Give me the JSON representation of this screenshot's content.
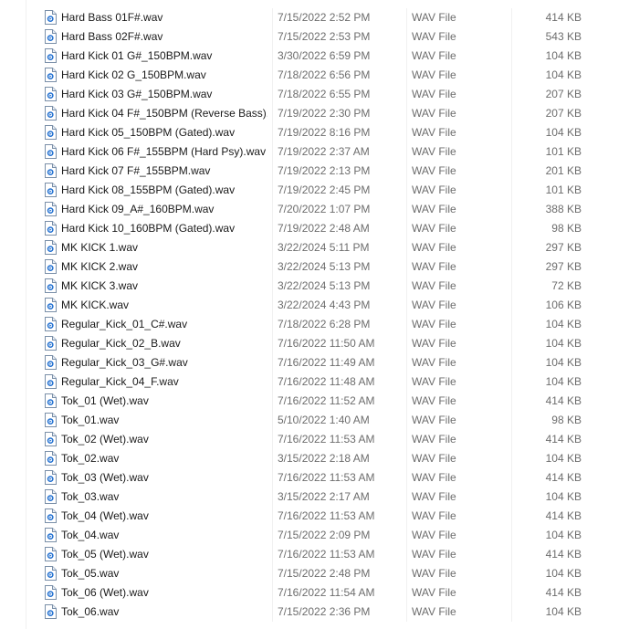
{
  "colors": {
    "icon_blue": "#1f6fd1",
    "secondary_text": "#6d6d6d"
  },
  "icon": "wav-audio-file-icon",
  "files": [
    {
      "name": "Hard Bass 01F#.wav",
      "date": "7/15/2022 2:52 PM",
      "type": "WAV File",
      "size": "414 KB"
    },
    {
      "name": "Hard Bass 02F#.wav",
      "date": "7/15/2022 2:53 PM",
      "type": "WAV File",
      "size": "543 KB"
    },
    {
      "name": "Hard Kick 01 G#_150BPM.wav",
      "date": "3/30/2022 6:59 PM",
      "type": "WAV File",
      "size": "104 KB"
    },
    {
      "name": "Hard Kick 02 G_150BPM.wav",
      "date": "7/18/2022 6:56 PM",
      "type": "WAV File",
      "size": "104 KB"
    },
    {
      "name": "Hard Kick 03 G#_150BPM.wav",
      "date": "7/18/2022 6:55 PM",
      "type": "WAV File",
      "size": "207 KB"
    },
    {
      "name": "Hard Kick 04 F#_150BPM (Reverse Bass)....",
      "date": "7/19/2022 2:30 PM",
      "type": "WAV File",
      "size": "207 KB"
    },
    {
      "name": "Hard Kick 05_150BPM (Gated).wav",
      "date": "7/19/2022 8:16 PM",
      "type": "WAV File",
      "size": "104 KB"
    },
    {
      "name": "Hard Kick 06 F#_155BPM (Hard Psy).wav",
      "date": "7/19/2022 2:37 AM",
      "type": "WAV File",
      "size": "101 KB"
    },
    {
      "name": "Hard Kick 07 F#_155BPM.wav",
      "date": "7/19/2022 2:13 PM",
      "type": "WAV File",
      "size": "201 KB"
    },
    {
      "name": "Hard Kick 08_155BPM (Gated).wav",
      "date": "7/19/2022 2:45 PM",
      "type": "WAV File",
      "size": "101 KB"
    },
    {
      "name": "Hard Kick 09_A#_160BPM.wav",
      "date": "7/20/2022 1:07 PM",
      "type": "WAV File",
      "size": "388 KB"
    },
    {
      "name": "Hard Kick 10_160BPM (Gated).wav",
      "date": "7/19/2022 2:48 AM",
      "type": "WAV File",
      "size": "98 KB"
    },
    {
      "name": "MK KICK 1.wav",
      "date": "3/22/2024 5:11 PM",
      "type": "WAV File",
      "size": "297 KB"
    },
    {
      "name": "MK KICK 2.wav",
      "date": "3/22/2024 5:13 PM",
      "type": "WAV File",
      "size": "297 KB"
    },
    {
      "name": "MK KICK 3.wav",
      "date": "3/22/2024 5:13 PM",
      "type": "WAV File",
      "size": "72 KB"
    },
    {
      "name": "MK KICK.wav",
      "date": "3/22/2024 4:43 PM",
      "type": "WAV File",
      "size": "106 KB"
    },
    {
      "name": "Regular_Kick_01_C#.wav",
      "date": "7/18/2022 6:28 PM",
      "type": "WAV File",
      "size": "104 KB"
    },
    {
      "name": "Regular_Kick_02_B.wav",
      "date": "7/16/2022 11:50 AM",
      "type": "WAV File",
      "size": "104 KB"
    },
    {
      "name": "Regular_Kick_03_G#.wav",
      "date": "7/16/2022 11:49 AM",
      "type": "WAV File",
      "size": "104 KB"
    },
    {
      "name": "Regular_Kick_04_F.wav",
      "date": "7/16/2022 11:48 AM",
      "type": "WAV File",
      "size": "104 KB"
    },
    {
      "name": "Tok_01 (Wet).wav",
      "date": "7/16/2022 11:52 AM",
      "type": "WAV File",
      "size": "414 KB"
    },
    {
      "name": "Tok_01.wav",
      "date": "5/10/2022 1:40 AM",
      "type": "WAV File",
      "size": "98 KB"
    },
    {
      "name": "Tok_02 (Wet).wav",
      "date": "7/16/2022 11:53 AM",
      "type": "WAV File",
      "size": "414 KB"
    },
    {
      "name": "Tok_02.wav",
      "date": "3/15/2022 2:18 AM",
      "type": "WAV File",
      "size": "104 KB"
    },
    {
      "name": "Tok_03 (Wet).wav",
      "date": "7/16/2022 11:53 AM",
      "type": "WAV File",
      "size": "414 KB"
    },
    {
      "name": "Tok_03.wav",
      "date": "3/15/2022 2:17 AM",
      "type": "WAV File",
      "size": "104 KB"
    },
    {
      "name": "Tok_04 (Wet).wav",
      "date": "7/16/2022 11:53 AM",
      "type": "WAV File",
      "size": "414 KB"
    },
    {
      "name": "Tok_04.wav",
      "date": "7/15/2022 2:09 PM",
      "type": "WAV File",
      "size": "104 KB"
    },
    {
      "name": "Tok_05 (Wet).wav",
      "date": "7/16/2022 11:53 AM",
      "type": "WAV File",
      "size": "414 KB"
    },
    {
      "name": "Tok_05.wav",
      "date": "7/15/2022 2:48 PM",
      "type": "WAV File",
      "size": "104 KB"
    },
    {
      "name": "Tok_06 (Wet).wav",
      "date": "7/16/2022 11:54 AM",
      "type": "WAV File",
      "size": "414 KB"
    },
    {
      "name": "Tok_06.wav",
      "date": "7/15/2022 2:36 PM",
      "type": "WAV File",
      "size": "104 KB"
    }
  ]
}
